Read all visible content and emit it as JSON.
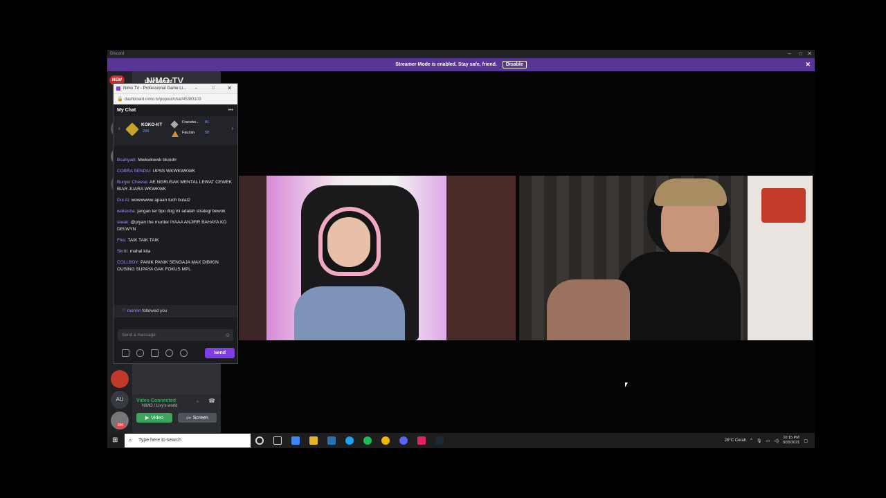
{
  "discord": {
    "window_title": "Discord",
    "streamer_banner": "Streamer Mode is enabled. Stay safe, friend.",
    "disable_label": "Disable",
    "server_name": "Livy's world",
    "new_badge": "NEW",
    "guild_initials": "AU",
    "guild_badge": "990",
    "voice": {
      "status": "Video Connected",
      "channel": "NIMO / Livy's world",
      "video_label": "Video",
      "screen_label": "Screen"
    }
  },
  "nimo": {
    "brand": "NIMO TV",
    "window_title": "Nimo TV - Professional Game Li...",
    "url": "dashboard.nimo.tv/popout/chat/45383103",
    "panel_title": "My Chat",
    "top_donors": [
      {
        "name": "KOKO-KT",
        "value": "299"
      },
      {
        "name": "Fracebo...",
        "value": "81"
      },
      {
        "name": "Fauzan",
        "value": "58"
      }
    ],
    "messages": [
      {
        "user": "Bcahyadi:",
        "text": "Mwkwkwwk blundrr"
      },
      {
        "user": "COBRA SENPAI:",
        "text": "UPSS WKWKWKWK"
      },
      {
        "user": "Burger Cheese:",
        "text": "AE NGRUSAK MENTAL LEWAT CEWEK BIAR JUARA WKWKWK"
      },
      {
        "user": "Dui Al:",
        "text": "wowwwww apaan tuch bulat2"
      },
      {
        "user": "wakasha:",
        "text": "jangan ter tipu dog ini adalah strategi bewok"
      },
      {
        "user": "siwak:",
        "text": "@piyan the murder IYAAA ANJIRR BAHAYA KO DELWYN"
      },
      {
        "user": "Fiks:",
        "text": "TAIK TAIK TAIK"
      },
      {
        "user": "Skrttt:",
        "text": "mahal kita"
      },
      {
        "user": "COLLBOY:",
        "text": "PANIK PANIK SENGAJA MAX DIBIKIN OUSING SUPAYA GAK FOKUS MPL"
      }
    ],
    "follow": {
      "user": "monnn",
      "text": "followed you"
    },
    "input_placeholder": "Send a message",
    "send_label": "Send"
  },
  "taskbar": {
    "search_placeholder": "Type here to search",
    "weather": "28°C Cerah",
    "time": "10:15 PM",
    "date": "9/15/2021"
  },
  "colors": {
    "streamer_bar": "#593695",
    "nimo_accent": "#7b3fe4",
    "voice_green": "#3ba55d"
  }
}
